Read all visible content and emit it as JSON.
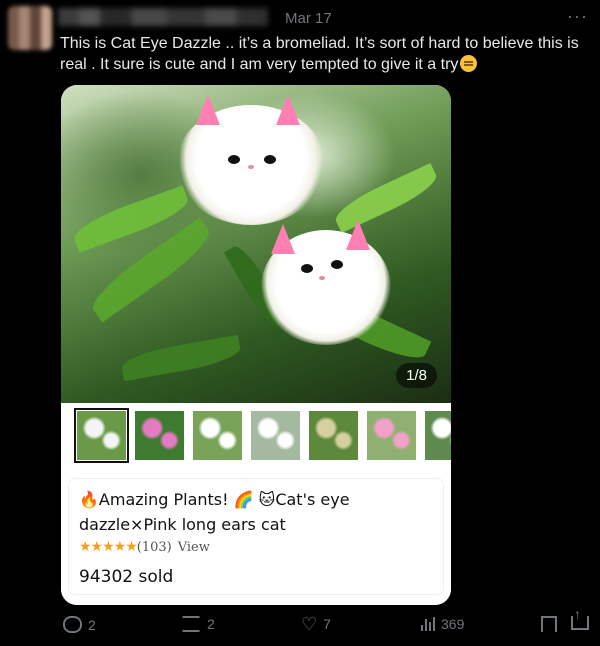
{
  "tweet": {
    "date": "Mar 17",
    "more": "···",
    "text": "This is Cat Eye Dazzle .. it’s a bromeliad. It’s sort of hard to believe this is real . It sure is cute and I am very tempted to give it a try"
  },
  "card": {
    "counter": "1/8",
    "title": "🔥Amazing Plants! 🌈 🐱Cat's eye dazzle×Pink long ears cat",
    "stars": "★★★★★",
    "reviews": "(103)",
    "view_label": "View",
    "sold": "94302 sold",
    "thumbnails": [
      {
        "name": "thumb-1",
        "bg": "#6a9a48",
        "accent": "#f4f4f4"
      },
      {
        "name": "thumb-2",
        "bg": "#3e7a2f",
        "accent": "#e37bc0"
      },
      {
        "name": "thumb-3",
        "bg": "#7aa35a",
        "accent": "#ffffff"
      },
      {
        "name": "thumb-4",
        "bg": "#a5b8a0",
        "accent": "#ffffff"
      },
      {
        "name": "thumb-5",
        "bg": "#5d8a3a",
        "accent": "#d8cfa0"
      },
      {
        "name": "thumb-6",
        "bg": "#8fb070",
        "accent": "#f2a1c9"
      },
      {
        "name": "thumb-7",
        "bg": "#5f8a4e",
        "accent": "#ffffff"
      }
    ]
  },
  "actions": {
    "replies": "2",
    "retweets": "2",
    "likes": "7",
    "views": "369"
  },
  "colors": {
    "background": "#000000",
    "text": "#e7e9ea",
    "muted": "#71767b",
    "star": "#f0a31a"
  }
}
